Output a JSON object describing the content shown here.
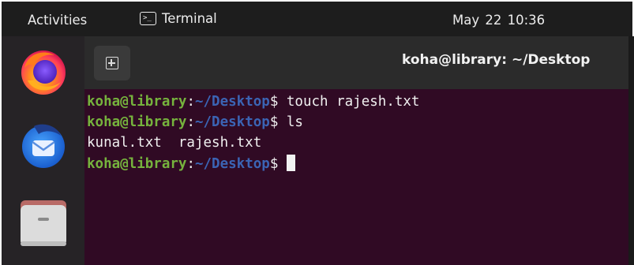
{
  "topbar": {
    "activities_label": "Activities",
    "app_icon": "terminal-icon",
    "app_name": "Terminal",
    "clock": "May 22  10:36"
  },
  "dock": {
    "items": [
      {
        "icon": "firefox-icon"
      },
      {
        "icon": "thunderbird-icon"
      },
      {
        "icon": "files-icon"
      }
    ]
  },
  "terminal": {
    "new_tab_icon": "new-tab-icon",
    "title": "koha@library: ~/Desktop",
    "lines": [
      {
        "user": "koha@library",
        "colon": ":",
        "path": "~/Desktop",
        "sigil": "$",
        "command": " touch rajesh.txt"
      },
      {
        "user": "koha@library",
        "colon": ":",
        "path": "~/Desktop",
        "sigil": "$",
        "command": " ls"
      },
      {
        "output": "kunal.txt  rajesh.txt"
      },
      {
        "user": "koha@library",
        "colon": ":",
        "path": "~/Desktop",
        "sigil": "$",
        "command": " "
      }
    ]
  },
  "colors": {
    "topbar_bg": "#1d1d1d",
    "dock_bg": "#262326",
    "terminal_bg": "#300a24",
    "prompt_user": "#76b33d",
    "prompt_path": "#3b64b4"
  }
}
